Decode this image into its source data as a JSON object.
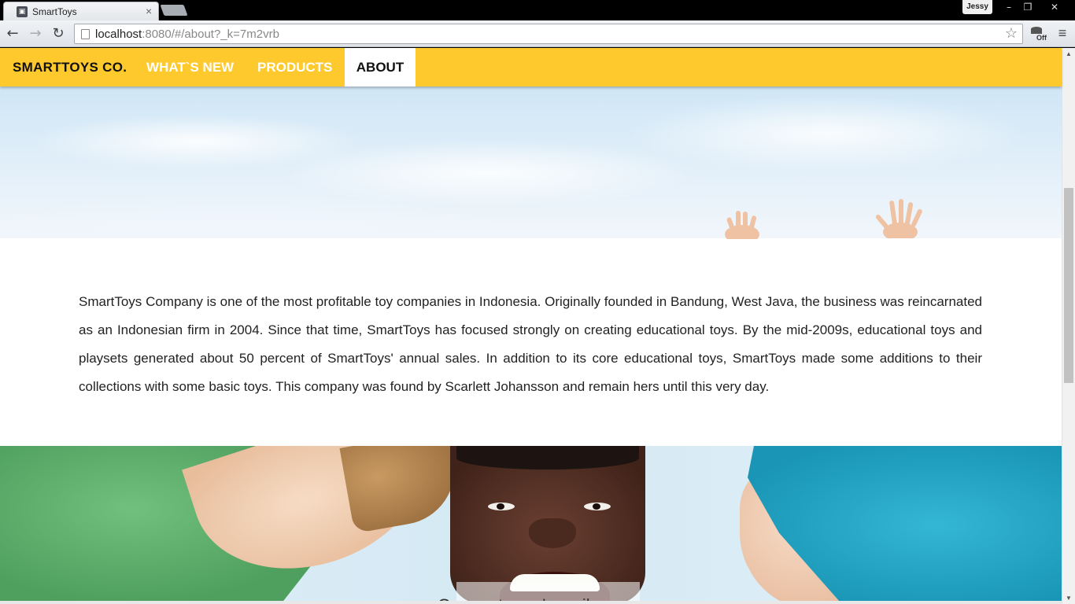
{
  "browser": {
    "tab": {
      "title": "SmartToys",
      "favicon": "smarttoys-favicon",
      "close_label": "×"
    },
    "user_badge": "Jessy",
    "window_controls": {
      "minimize": "–",
      "restore": "❐",
      "close": "✕"
    },
    "nav": {
      "back": "←",
      "forward": "→",
      "reload": "↻"
    },
    "url": {
      "host": "localhost",
      "rest": ":8080/#/about?_k=7m2vrb"
    },
    "bookmark_icon": "☆",
    "extension_label": "Off",
    "menu_icon": "≡"
  },
  "site": {
    "nav": {
      "brand": "SMARTTOYS CO.",
      "items": [
        {
          "label": "WHAT`S NEW",
          "active": false
        },
        {
          "label": "PRODUCTS",
          "active": false
        },
        {
          "label": "ABOUT",
          "active": true
        }
      ]
    },
    "about": {
      "paragraph": "SmartToys Company is one of the most profitable toy companies in Indonesia. Originally founded in Bandung, West Java, the business was reincarnated as an Indonesian firm in 2004. Since that time, SmartToys has focused strongly on creating educational toys. By the mid-2009s, educational toys and playsets generated about 50 percent of SmartToys' annual sales. In addition to its core educational toys, SmartToys made some additions to their collections with some basic toys. This company was found by Scarlett Johansson and remain hers until this very day."
    },
    "photo_caption": "Our customer's smiles"
  },
  "colors": {
    "nav_bg": "#fdc92d",
    "nav_text": "#ffffff",
    "brand_text": "#111111",
    "active_tab_bg": "#ffffff"
  },
  "scrollbar": {
    "arrow_up": "▲",
    "arrow_down": "▼"
  }
}
